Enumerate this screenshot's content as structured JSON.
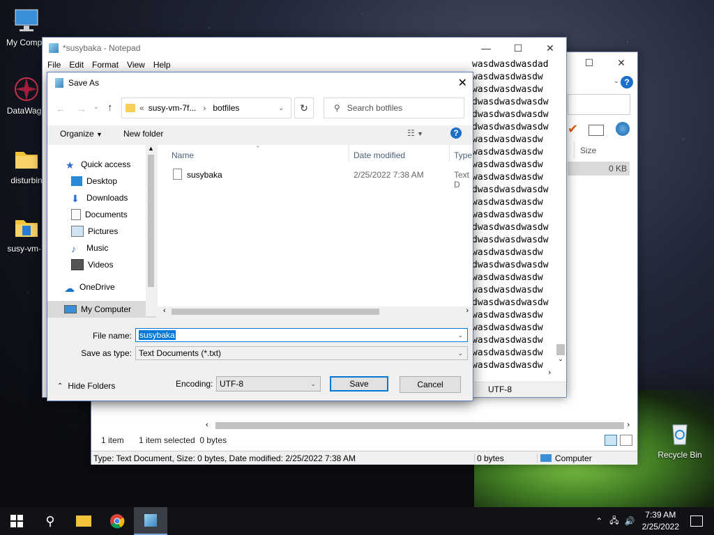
{
  "desktop": {
    "icons": [
      {
        "label": "My Compu",
        "icon": "computer-icon"
      },
      {
        "label": "DataWago",
        "icon": "datawago-icon"
      },
      {
        "label": "disturbin",
        "icon": "folder-icon"
      },
      {
        "label": "susy-vm-7",
        "icon": "folder-icon"
      },
      {
        "label": "Recycle Bin",
        "icon": "recycle-bin-icon"
      }
    ]
  },
  "notepad": {
    "title": "*susybaka - Notepad",
    "menu": [
      "File",
      "Edit",
      "Format",
      "View",
      "Help"
    ],
    "lines": [
      "wasdwasdwasdad",
      "wasdwasdwasdw",
      "wasdwasdwasdw",
      "dwasdwasdwasdw",
      "dwasdwasdwasdw",
      "dwasdwasdwasdw",
      "wasdwasdwasdw",
      "wasdwasdwasdw",
      "wasdwasdwasdw",
      "wasdwasdwasdw",
      "dwasdwasdwasdw",
      "wasdwasdwasdw",
      "wasdwasdwasdw",
      "dwasdwasdwasdw",
      "dwasdwasdwasdw",
      "wasdwasdwasdw",
      "dwasdwasdwasdw",
      "wasdwasdwasdw",
      "wasdwasdwasdw",
      "dwasdwasdwasdw",
      "wasdwasdwasdw",
      "wasdwasdwasdw",
      "wasdwasdwasdw",
      "wasdwasdwasdw",
      "wasdwasdwasdw"
    ],
    "status_encoding": "UTF-8"
  },
  "explorer": {
    "col_size": "Size",
    "row_size": "0 KB",
    "status_items": "1 item",
    "status_selected": "1 item selected  0 bytes",
    "details_bar": "Type: Text Document, Size: 0 bytes, Date modified: 2/25/2022 7:38 AM",
    "details_size": "0 bytes",
    "details_location": "Computer"
  },
  "dialog": {
    "title": "Save As",
    "breadcrumb": [
      "«",
      "susy-vm-7f...",
      "›",
      "botfiles"
    ],
    "search_placeholder": "Search botfiles",
    "organize": "Organize",
    "new_folder": "New folder",
    "nav": {
      "quick_access": "Quick access",
      "items": [
        {
          "label": "Desktop",
          "icon": "desktop-icon"
        },
        {
          "label": "Downloads",
          "icon": "downloads-icon"
        },
        {
          "label": "Documents",
          "icon": "documents-icon"
        },
        {
          "label": "Pictures",
          "icon": "pictures-icon"
        },
        {
          "label": "Music",
          "icon": "music-icon"
        },
        {
          "label": "Videos",
          "icon": "videos-icon"
        }
      ],
      "onedrive": "OneDrive",
      "my_computer": "My Computer"
    },
    "columns": {
      "name": "Name",
      "date": "Date modified",
      "type": "Type"
    },
    "files": [
      {
        "name": "susybaka",
        "date": "2/25/2022 7:38 AM",
        "type": "Text D"
      }
    ],
    "file_name_label": "File name:",
    "file_name_value": "susybaka",
    "save_type_label": "Save as type:",
    "save_type_value": "Text Documents (*.txt)",
    "hide_folders": "Hide Folders",
    "encoding_label": "Encoding:",
    "encoding_value": "UTF-8",
    "save": "Save",
    "cancel": "Cancel"
  },
  "taskbar": {
    "time": "7:39 AM",
    "date": "2/25/2022"
  },
  "colors": {
    "accent": "#0078d7",
    "selection": "#cce8ff"
  }
}
